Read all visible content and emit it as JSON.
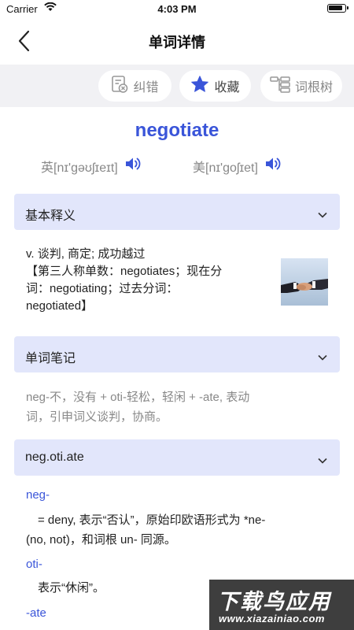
{
  "status_bar": {
    "carrier": "Carrier",
    "time": "4:03 PM"
  },
  "nav": {
    "title": "单词详情",
    "back_icon": "chevron-left-icon"
  },
  "toolbar": {
    "correct_label": "纠错",
    "favorite_label": "收藏",
    "root_tree_label": "词根树",
    "accent_color": "#3a55d9"
  },
  "word": {
    "headword": "negotiate",
    "uk_phonetic": "英[nɪ'gəʊʃɪeɪt]",
    "us_phonetic": "美[nɪ'goʃɪet]"
  },
  "basic_definition": {
    "header": "基本释义",
    "lines": [
      "v. 谈判, 商定; 成功越过",
      "【第三人称单数：negotiates；现在分",
      "词：negotiating；过去分词：",
      "negotiated】"
    ]
  },
  "word_notes": {
    "header": "单词笔记",
    "lines": [
      "neg-不，没有 + oti-轻松，轻闲 + -ate, 表动",
      "词，引申词义谈判，协商。"
    ]
  },
  "breakdown": {
    "header": "neg.oti.ate",
    "parts": [
      {
        "term": "neg-",
        "desc_lines": [
          "= deny, 表示“否认”，原始印欧语形式为 *ne-",
          "(no, not)，和词根 un- 同源。"
        ]
      },
      {
        "term": "oti-",
        "desc_lines": [
          "表示“休闲”。"
        ]
      },
      {
        "term": "-ate",
        "desc_lines": []
      }
    ]
  },
  "watermark": {
    "main": "下载鸟应用",
    "url": "www.xiazainiao.com"
  }
}
